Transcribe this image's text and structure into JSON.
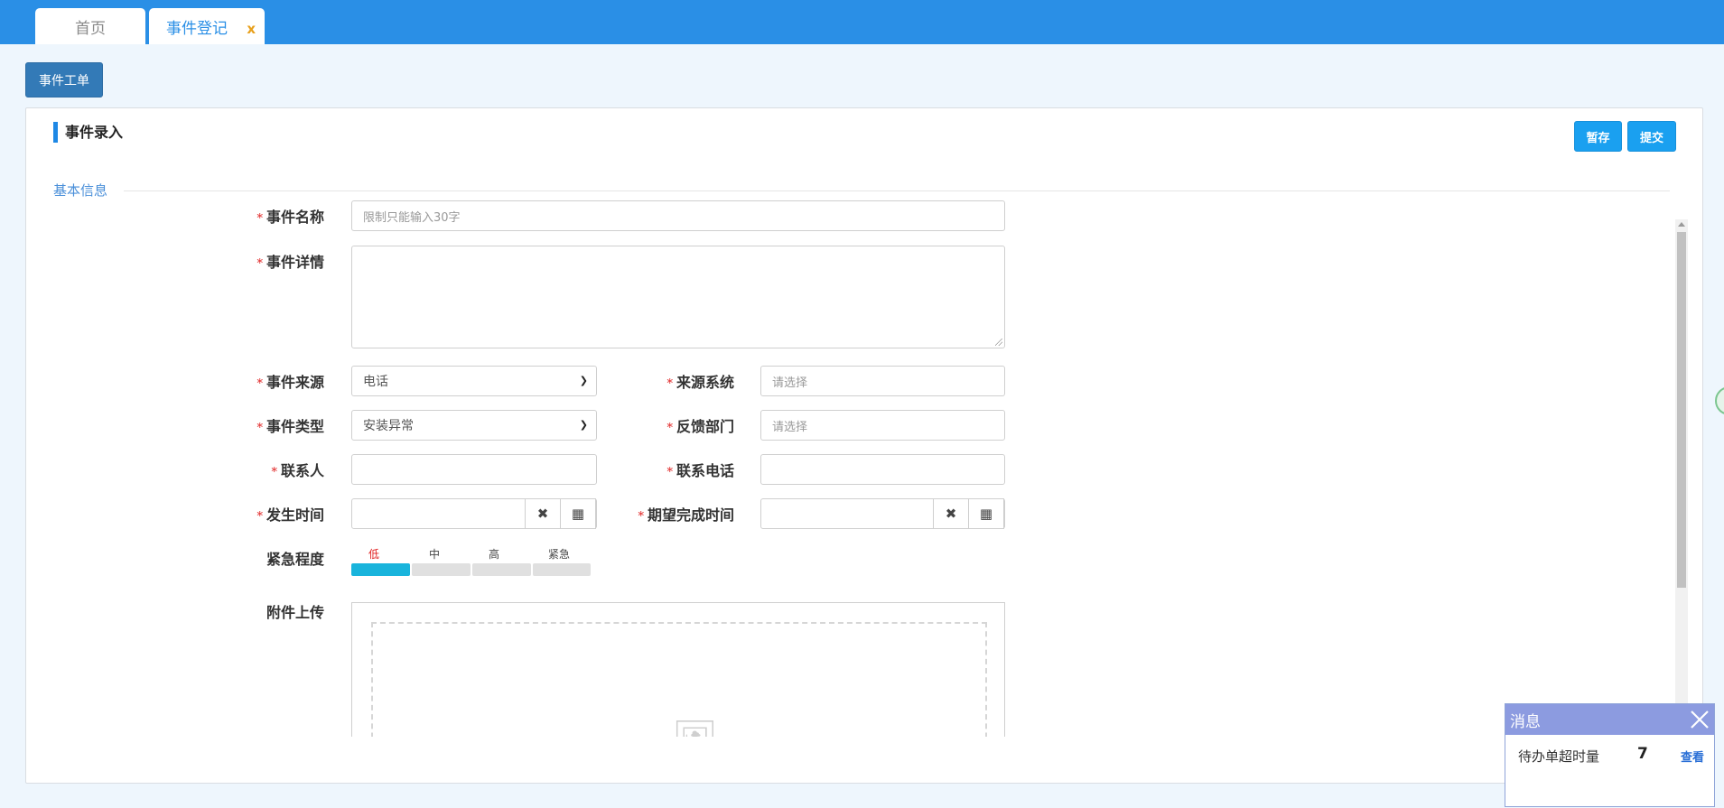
{
  "tabs": {
    "home": "首页",
    "event": "事件登记",
    "close": "x"
  },
  "toolbar": {
    "ticket": "事件工单"
  },
  "panel": {
    "title": "事件录入",
    "save": "暂存",
    "submit": "提交",
    "section": "基本信息"
  },
  "form": {
    "required_mark": "*",
    "name_label": "事件名称",
    "name_placeholder": "限制只能输入30字",
    "detail_label": "事件详情",
    "source_label": "事件来源",
    "source_value": "电话",
    "source_system_label": "来源系统",
    "source_system_placeholder": "请选择",
    "type_label": "事件类型",
    "type_value": "安装异常",
    "feedback_dept_label": "反馈部门",
    "feedback_dept_placeholder": "请选择",
    "contact_label": "联系人",
    "phone_label": "联系电话",
    "occur_time_label": "发生时间",
    "expect_time_label": "期望完成时间",
    "urgency_label": "紧急程度",
    "urgency_levels": [
      "低",
      "中",
      "高",
      "紧急"
    ],
    "urgency_selected": "低",
    "attachment_label": "附件上传"
  },
  "colors": {
    "topbar": "#2a8fe6",
    "urgency_active": "#19b4dc",
    "urgency_active_text": "#e02020"
  },
  "message": {
    "title": "消息",
    "text": "待办单超时量",
    "count": "7",
    "link": "查看"
  }
}
